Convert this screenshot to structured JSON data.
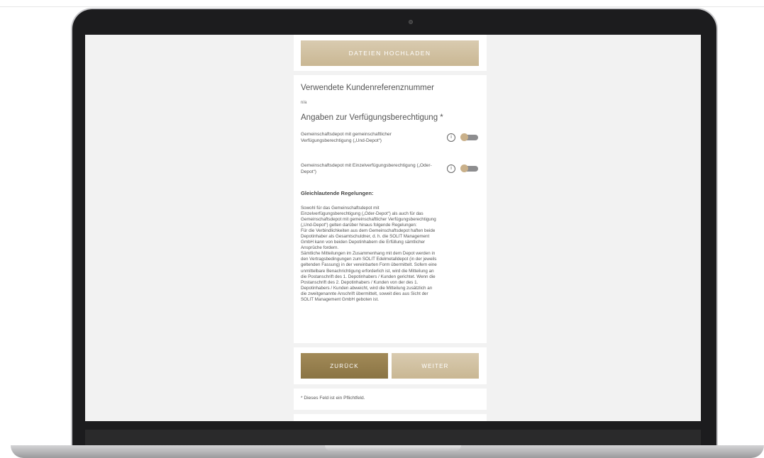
{
  "form": {
    "upload_label": "DATEIEN HOCHLADEN",
    "reference_heading": "Verwendete Kundenreferenznummer",
    "reference_value": "n/a",
    "authorization_heading": "Angaben zur Verfügungsberechtigung *",
    "options": [
      {
        "label": "Gemeinschaftsdepot mit gemeinschaftlicher Verfügungsberechtigung („Und-Depot“)",
        "enabled": false
      },
      {
        "label": "Gemeinschaftsdepot mit Einzelverfügungsberechtigung („Oder-Depot“)",
        "enabled": false
      }
    ],
    "info_glyph": "i",
    "rules_heading": "Gleichlautende Regelungen:",
    "rules_text": "Sowohl für das Gemeinschaftsdepot mit\nEinzelverfügungsberechtigung („Oder-Depot“) als auch für das\nGemeinschaftsdepot mit gemeinschaftlicher Verfügungsberechtigung\n(„Und-Depot“) gelten darüber hinaus folgende Regelungen:\nFür die Verbindlichkeiten aus dem Gemeinschaftsdepot haften beide\nDepotinhaber als Gesamtschuldner, d. h. die SOLIT Management\nGmbH kann von beiden Depotinhabern die Erfüllung sämtlicher\nAnsprüche fordern.\nSämtliche Mitteilungen im Zusammenhang mit dem Depot werden in\nden Vertragsbedingungen zum SOLIT Edelmetalldepot (in der jeweils\ngeltenden Fassung) in der vereinbarten Form übermittelt. Sofern eine\nunmittelbare Benachrichtigung erforderlich ist, wird die Mitteilung an\ndie Postanschrift des 1. Depotinhabers / Kunden gerichtet. Wenn die\nPostanschrift des 2. Depotinhabers / Kunden von der des 1.\nDepotinhabers / Kunden abweicht, wird die Mitteilung zusätzlich an\ndie zweitgenannte Anschrift übermittelt, soweit dies aus Sicht der\nSOLIT Management GmbH geboten ist.",
    "back_label": "ZURÜCK",
    "next_label": "WEITER",
    "required_note": "* Dieses Feld ist ein Pflichtfeld."
  },
  "colors": {
    "gold_dark": "#8a7444",
    "gold_light": "#c9b793",
    "toggle_knob": "#c9b08a"
  }
}
